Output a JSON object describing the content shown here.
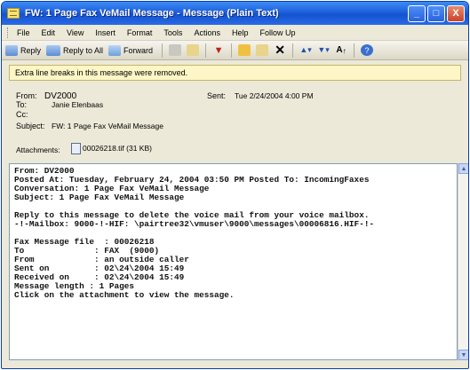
{
  "window": {
    "title": "FW: 1 Page Fax VeMail Message - Message (Plain Text)",
    "minimize": "_",
    "maximize": "□",
    "close": "X"
  },
  "menu": [
    "File",
    "Edit",
    "View",
    "Insert",
    "Format",
    "Tools",
    "Actions",
    "Help",
    "Follow Up"
  ],
  "toolbar": {
    "reply": "Reply",
    "reply_all": "Reply to All",
    "forward": "Forward",
    "icons": [
      "reply-icon",
      "reply-all-icon",
      "forward-icon",
      "print-icon",
      "move-icon",
      "flag-icon",
      "categories-icon",
      "delete-icon",
      "previous-icon",
      "next-icon",
      "font-size-icon",
      "help-icon"
    ]
  },
  "infobar": "Extra line breaks in this message were removed.",
  "header": {
    "from_label": "From:",
    "from": "DV2000",
    "to_label": "To:",
    "to": "Janie Elenbaas",
    "cc_label": "Cc:",
    "cc": "",
    "subject_label": "Subject:",
    "subject": "FW: 1 Page Fax VeMail Message",
    "sent_label": "Sent:",
    "sent": "Tue 2/24/2004 4:00 PM",
    "attachments_label": "Attachments:",
    "attachment": "00026218.tif (31 KB)"
  },
  "body": [
    "From: DV2000",
    "Posted At: Tuesday, February 24, 2004 03:50 PM Posted To: IncomingFaxes",
    "Conversation: 1 Page Fax VeMail Message",
    "Subject: 1 Page Fax VeMail Message",
    "",
    "Reply to this message to delete the voice mail from your voice mailbox.",
    "-!-Mailbox: 9000-!-HIF: \\pairtree32\\vmuser\\9000\\messages\\00006816.HIF-!-",
    "",
    "Fax Message file  : 00026218",
    "To              : FAX  (9000)",
    "From            : an outside caller",
    "Sent on         : 02\\24\\2004 15:49",
    "Received on     : 02\\24\\2004 15:49",
    "Message length : 1 Pages",
    "Click on the attachment to view the message."
  ],
  "colors": {
    "titlebar": "#1f5fdc",
    "infobar": "#fdf6c6",
    "body_border": "#7f9db9"
  }
}
